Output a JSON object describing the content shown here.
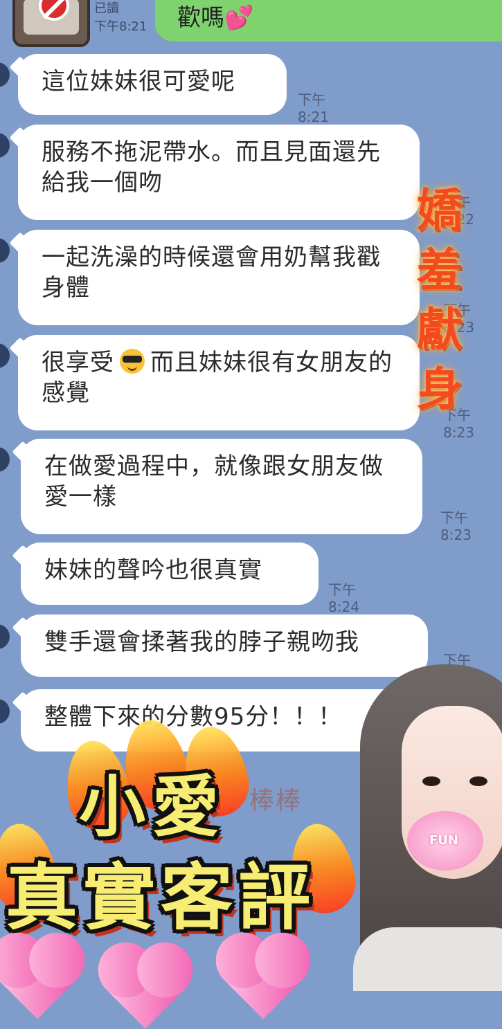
{
  "top": {
    "read_label": "已讀",
    "time": "下午8:21",
    "sent_text": "歡嗎",
    "sent_emoji": "💕"
  },
  "messages": [
    {
      "text": "這位妹妹很可愛呢",
      "time": "下午 8:21"
    },
    {
      "text": "服務不拖泥帶水。而且見面還先給我一個吻",
      "time": "下午 8:22"
    },
    {
      "text": "一起洗澡的時候還會用奶幫我戳身體",
      "time": "下午 8:23"
    },
    {
      "text_before": "很享受",
      "text_after": "而且妹妹很有女朋友的感覺",
      "time": "下午 8:23"
    },
    {
      "text": "在做愛過程中，就像跟女朋友做愛一樣",
      "time": "下午 8:23"
    },
    {
      "text": "妹妹的聲吟也很真實",
      "time": "下午 8:24"
    },
    {
      "text": "雙手還會揉著我的脖子親吻我",
      "time": "下午 8:24"
    },
    {
      "text": "整體下來的分數95分！！！",
      "time": ""
    }
  ],
  "decor": {
    "vertical_words": [
      "嬌",
      "羞",
      "獻",
      "身"
    ],
    "title_line1": "小愛",
    "title_line2": "真實客評",
    "stamp": "棒棒",
    "portrait_tag": "FUN"
  },
  "colors": {
    "background": "#7f9ccb",
    "sent_bubble": "#7ed36e",
    "received_bubble": "#ffffff",
    "title_yellow": "#f7ed72",
    "title_shadow": "#c2331b",
    "vertical_text": "#f34b1f"
  }
}
